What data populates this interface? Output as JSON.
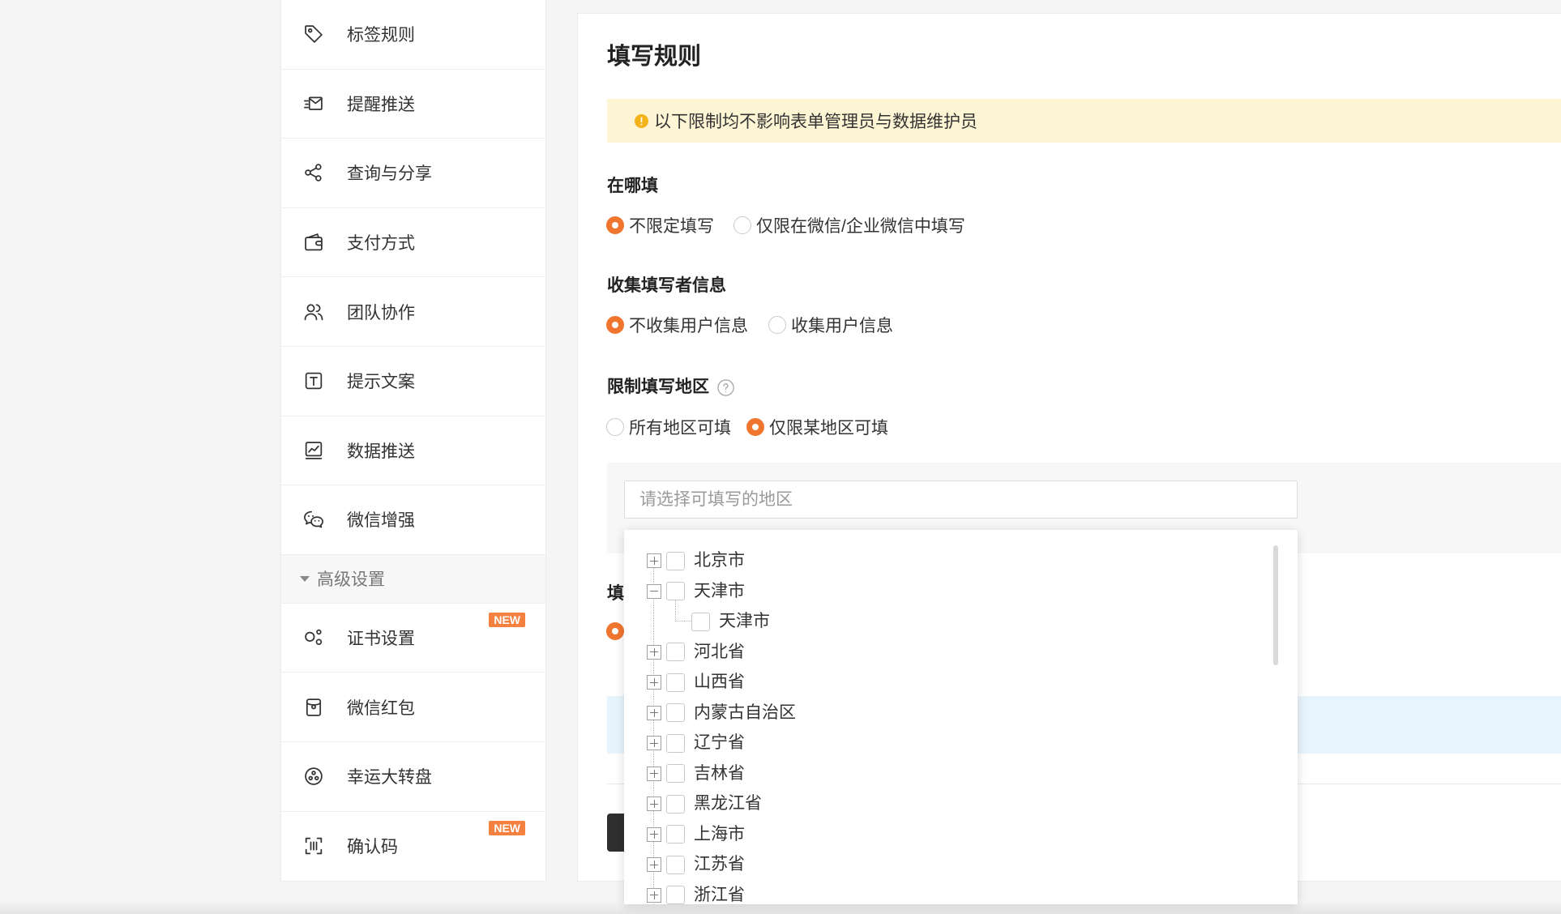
{
  "colors": {
    "accent": "#f0762f",
    "notice_bg": "#fdf5d4",
    "notice_icon": "#f4b31b",
    "info_bg": "#e8f4fd",
    "badge": "#f58140"
  },
  "sidebar": {
    "items": [
      {
        "label": "标签规则",
        "icon": "tag-icon"
      },
      {
        "label": "提醒推送",
        "icon": "send-notification-icon"
      },
      {
        "label": "查询与分享",
        "icon": "share-icon"
      },
      {
        "label": "支付方式",
        "icon": "wallet-icon"
      },
      {
        "label": "团队协作",
        "icon": "team-icon"
      },
      {
        "label": "提示文案",
        "icon": "text-box-icon"
      },
      {
        "label": "数据推送",
        "icon": "chart-icon"
      },
      {
        "label": "微信增强",
        "icon": "wechat-icon"
      }
    ],
    "advanced": {
      "label": "高级设置",
      "icon": "caret-down-icon",
      "items": [
        {
          "label": "证书设置",
          "icon": "certificate-icon",
          "badge": "NEW"
        },
        {
          "label": "微信红包",
          "icon": "red-envelope-icon"
        },
        {
          "label": "幸运大转盘",
          "icon": "lucky-wheel-icon"
        },
        {
          "label": "确认码",
          "icon": "scan-code-icon",
          "badge": "NEW"
        }
      ]
    }
  },
  "main": {
    "title": "填写规则",
    "notice": {
      "icon": "warning-icon",
      "text": "以下限制均不影响表单管理员与数据维护员"
    },
    "where": {
      "label": "在哪填",
      "options": [
        {
          "label": "不限定填写",
          "checked": true
        },
        {
          "label": "仅限在微信/企业微信中填写",
          "checked": false
        }
      ]
    },
    "collect": {
      "label": "收集填写者信息",
      "options": [
        {
          "label": "不收集用户信息",
          "checked": true
        },
        {
          "label": "收集用户信息",
          "checked": false
        }
      ]
    },
    "region": {
      "label": "限制填写地区",
      "help_icon": "question-icon",
      "options": [
        {
          "label": "所有地区可填",
          "checked": false
        },
        {
          "label": "仅限某地区可填",
          "checked": true
        }
      ],
      "placeholder": "请选择可填写的地区"
    },
    "next_section": {
      "label": "填",
      "options": [
        {
          "checked": true
        }
      ]
    }
  },
  "region_tree": {
    "nodes": [
      {
        "label": "北京市",
        "expanded": false,
        "checked": false
      },
      {
        "label": "天津市",
        "expanded": true,
        "checked": false,
        "children": [
          {
            "label": "天津市",
            "checked": false
          }
        ]
      },
      {
        "label": "河北省",
        "expanded": false,
        "checked": false
      },
      {
        "label": "山西省",
        "expanded": false,
        "checked": false
      },
      {
        "label": "内蒙古自治区",
        "expanded": false,
        "checked": false
      },
      {
        "label": "辽宁省",
        "expanded": false,
        "checked": false
      },
      {
        "label": "吉林省",
        "expanded": false,
        "checked": false
      },
      {
        "label": "黑龙江省",
        "expanded": false,
        "checked": false
      },
      {
        "label": "上海市",
        "expanded": false,
        "checked": false
      },
      {
        "label": "江苏省",
        "expanded": false,
        "checked": false
      },
      {
        "label": "浙江省",
        "expanded": false,
        "checked": false
      }
    ]
  }
}
